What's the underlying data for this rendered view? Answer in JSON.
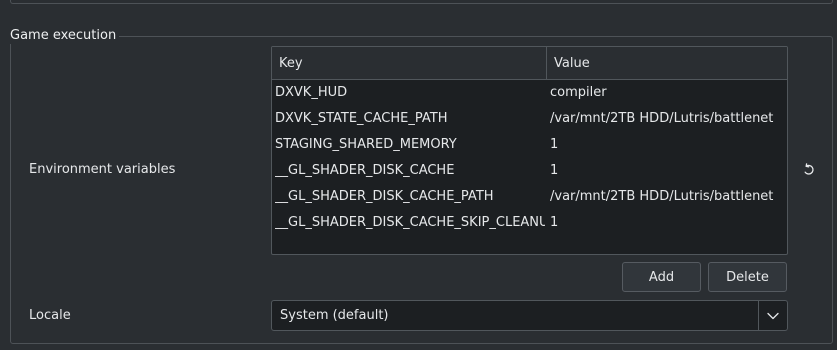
{
  "group": {
    "title": "Game execution"
  },
  "env": {
    "label": "Environment variables",
    "columns": {
      "key": "Key",
      "value": "Value"
    },
    "rows": [
      {
        "key": "DXVK_HUD",
        "value": "compiler"
      },
      {
        "key": "DXVK_STATE_CACHE_PATH",
        "value": "/var/mnt/2TB HDD/Lutris/battlenet"
      },
      {
        "key": "STAGING_SHARED_MEMORY",
        "value": "1"
      },
      {
        "key": "__GL_SHADER_DISK_CACHE",
        "value": "1"
      },
      {
        "key": "__GL_SHADER_DISK_CACHE_PATH",
        "value": "/var/mnt/2TB HDD/Lutris/battlenet"
      },
      {
        "key": "__GL_SHADER_DISK_CACHE_SKIP_CLEANUP",
        "value": "1"
      }
    ],
    "add_label": "Add",
    "delete_label": "Delete",
    "reset_icon": "reset-icon"
  },
  "locale": {
    "label": "Locale",
    "selected": "System (default)",
    "dropdown_icon": "chevron-down-icon"
  },
  "colors": {
    "background": "#2a2e32",
    "field_background": "#1c1f22",
    "border": "#51575c",
    "text": "#e6e8ea"
  }
}
